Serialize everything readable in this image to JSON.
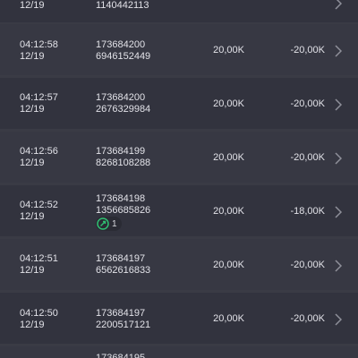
{
  "transactions": [
    {
      "time": "",
      "date": "12/19",
      "order_line1": "",
      "order_line2": "1140442113",
      "amount": "",
      "net": ""
    },
    {
      "time": "04:12:58",
      "date": "12/19",
      "order_line1": "173684200",
      "order_line2": "6946152449",
      "amount": "20,00K",
      "net": "-20,00K"
    },
    {
      "time": "04:12:57",
      "date": "12/19",
      "order_line1": "173684200",
      "order_line2": "2676329984",
      "amount": "20,00K",
      "net": "-20,00K"
    },
    {
      "time": "04:12:56",
      "date": "12/19",
      "order_line1": "173684199",
      "order_line2": "8268108288",
      "amount": "20,00K",
      "net": "-20,00K"
    },
    {
      "time": "04:12:52",
      "date": "12/19",
      "order_line1": "173684198",
      "order_line2": "1356685826",
      "amount": "20,00K",
      "net": "-18,00K",
      "badge": {
        "icon": "cashback-icon",
        "count": "1",
        "color": "#2fbf71"
      }
    },
    {
      "time": "04:12:51",
      "date": "12/19",
      "order_line1": "173684197",
      "order_line2": "6562616833",
      "amount": "20,00K",
      "net": "-20,00K"
    },
    {
      "time": "04:12:50",
      "date": "12/19",
      "order_line1": "173684197",
      "order_line2": "2200517121",
      "amount": "20,00K",
      "net": "-20,00K"
    },
    {
      "time": "",
      "date": "",
      "order_line1": "173684195",
      "order_line2": "",
      "amount": "",
      "net": ""
    }
  ],
  "icons": {
    "row_action": "chevron-right-icon"
  }
}
